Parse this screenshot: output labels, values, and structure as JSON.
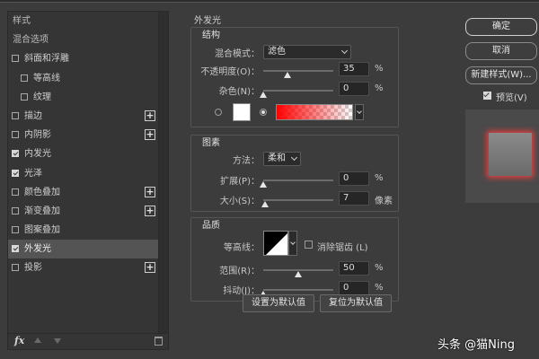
{
  "style_list": {
    "header": "样式",
    "blend_options": "混合选项",
    "items": [
      {
        "label": "斜面和浮雕",
        "checked": false,
        "plus": false
      },
      {
        "label": "等高线",
        "checked": false,
        "plus": false
      },
      {
        "label": "纹理",
        "checked": false,
        "plus": false
      },
      {
        "label": "描边",
        "checked": false,
        "plus": true
      },
      {
        "label": "内阴影",
        "checked": false,
        "plus": true
      },
      {
        "label": "内发光",
        "checked": true,
        "plus": false
      },
      {
        "label": "光泽",
        "checked": true,
        "plus": false
      },
      {
        "label": "颜色叠加",
        "checked": false,
        "plus": true
      },
      {
        "label": "渐变叠加",
        "checked": false,
        "plus": true
      },
      {
        "label": "图案叠加",
        "checked": false,
        "plus": false
      },
      {
        "label": "外发光",
        "checked": true,
        "plus": false
      },
      {
        "label": "投影",
        "checked": false,
        "plus": true
      }
    ],
    "footer_fx": "fx"
  },
  "outer_glow": {
    "title": "外发光",
    "structure": {
      "title": "结构",
      "blend_mode_label": "混合模式：",
      "blend_mode_value": "滤色",
      "opacity_label": "不透明度(O)：",
      "opacity_value": "35",
      "opacity_unit": "%",
      "opacity_level": 0.35,
      "noise_label": "杂色(N)：",
      "noise_value": "0",
      "noise_unit": "%",
      "noise_level": 0,
      "color_mode": "gradient",
      "gradient_color": "#ff0000"
    },
    "elements": {
      "title": "图素",
      "method_label": "方法：",
      "method_value": "柔和",
      "spread_label": "扩展(P)：",
      "spread_value": "0",
      "spread_unit": "%",
      "spread_level": 0,
      "size_label": "大小(S)：",
      "size_value": "7",
      "size_unit": "像素",
      "size_level": 0.03
    },
    "quality": {
      "title": "品质",
      "contour_label": "等高线：",
      "antialias_label": "消除锯齿 (L)",
      "antialias_checked": false,
      "range_label": "范围(R)：",
      "range_value": "50",
      "range_unit": "%",
      "range_level": 0.5,
      "jitter_label": "抖动(J)：",
      "jitter_value": "0",
      "jitter_unit": "%",
      "jitter_level": 0
    },
    "set_default_label": "设置为默认值",
    "reset_default_label": "复位为默认值"
  },
  "actions": {
    "ok_label": "确定",
    "cancel_label": "取消",
    "new_style_label": "新建样式(W)...",
    "preview_label": "预览(V)",
    "preview_checked": true
  },
  "watermark": "头条 @猫Ning"
}
